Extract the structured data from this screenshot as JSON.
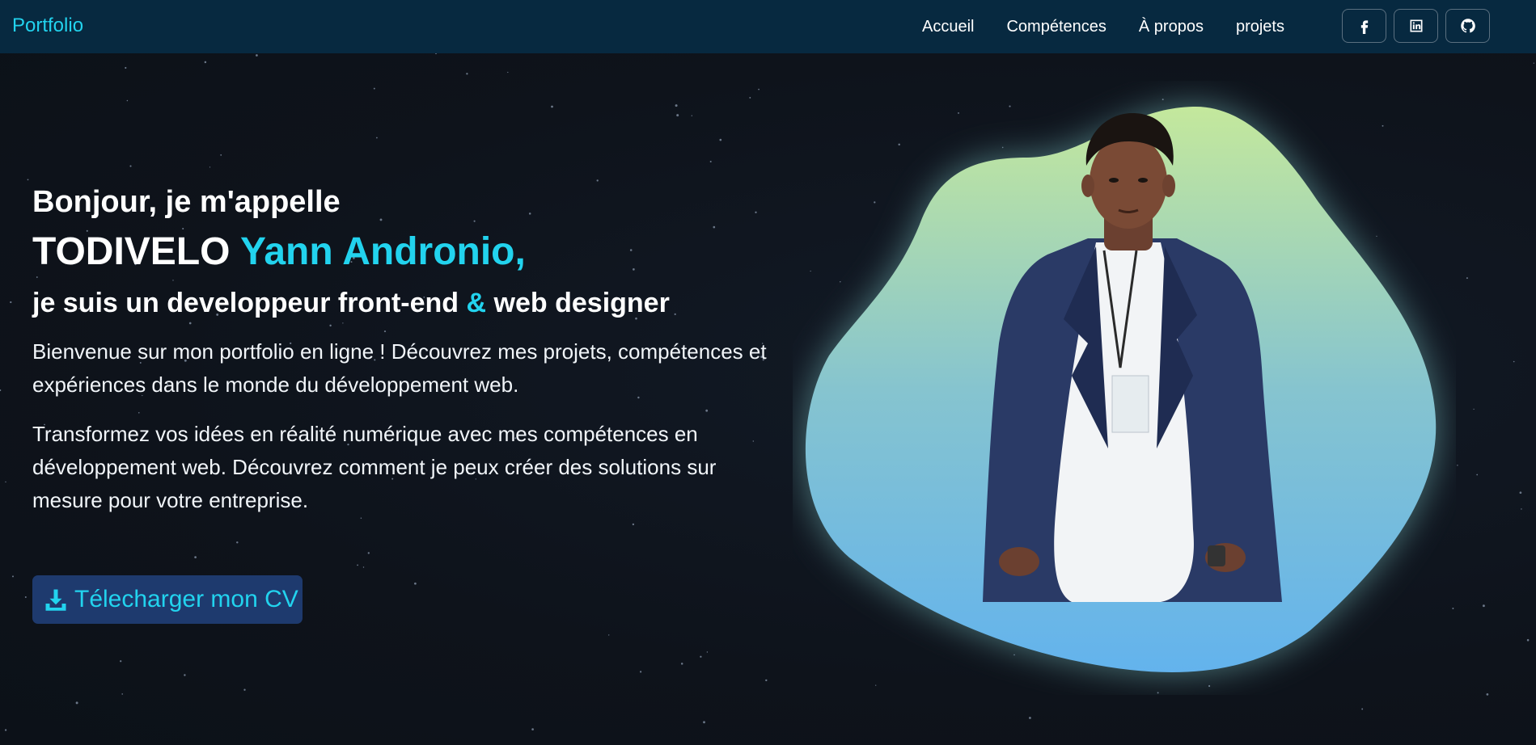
{
  "nav": {
    "brand": "Portfolio",
    "links": [
      "Accueil",
      "Compétences",
      "À propos",
      "projets"
    ],
    "socials": [
      {
        "icon": "facebook-icon"
      },
      {
        "icon": "linkedin-icon"
      },
      {
        "icon": "github-icon"
      }
    ]
  },
  "hero": {
    "greeting": "Bonjour, je m'appelle",
    "name_first": "TODIVELO",
    "name_accent": "Yann Andronio,",
    "role_start": "je suis un developpeur front-end",
    "role_amp": "&",
    "role_end": "web designer",
    "paragraph1": "Bienvenue sur mon portfolio en ligne ! Découvrez mes projets, compétences et expériences dans le monde du développement web.",
    "paragraph2": "Transformez vos idées en réalité numérique avec mes compétences en développement web. Découvrez comment je peux créer des solutions sur mesure pour votre entreprise.",
    "cv_button": "Télecharger mon CV",
    "cv_icon": "download-icon"
  },
  "colors": {
    "accent": "#22d3ee",
    "navbar_bg": "#072940",
    "page_bg": "#0f141c",
    "button_bg": "#1e3a6e",
    "blob_top": "#c4e89c",
    "blob_bottom": "#63b3ed"
  }
}
